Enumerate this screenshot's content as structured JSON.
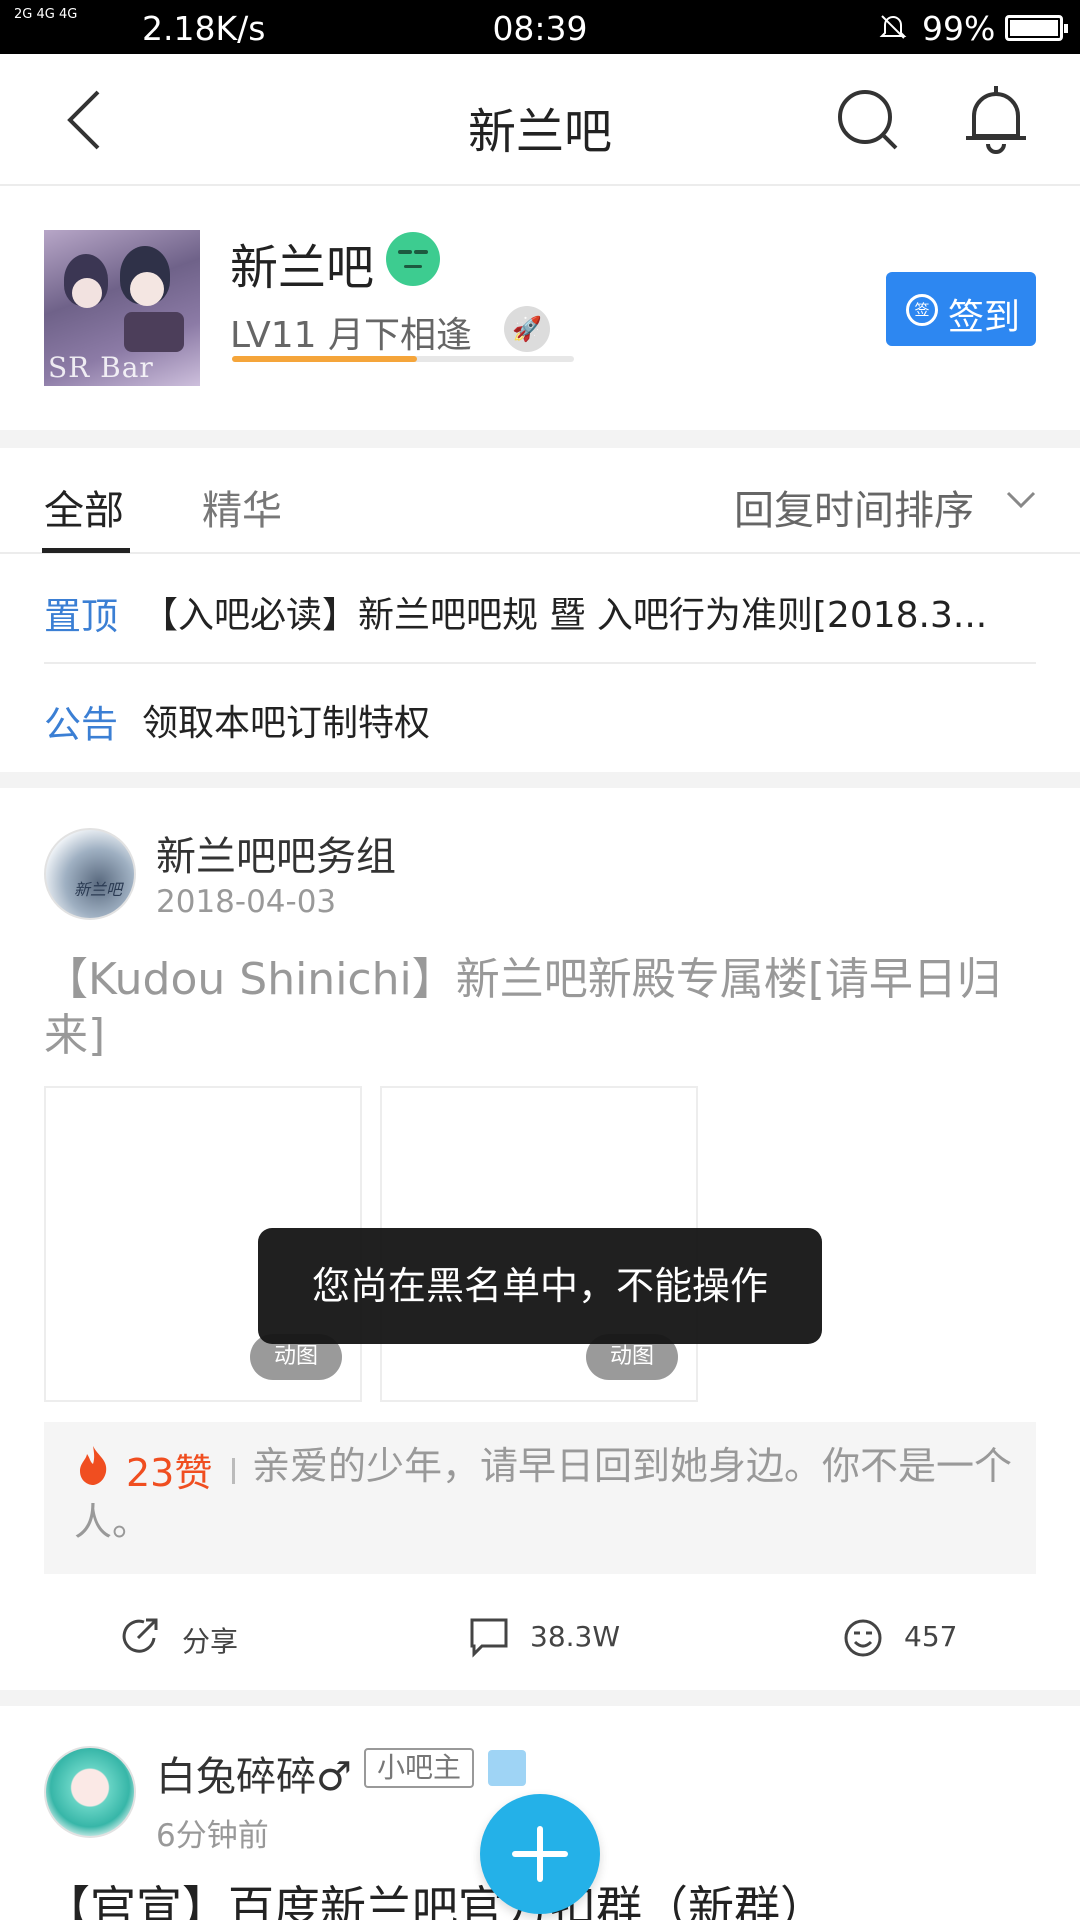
{
  "status_bar": {
    "signal_left": "2G 4G 4G",
    "net_speed": "2.18K/s",
    "time": "08:39",
    "battery": "99%"
  },
  "nav": {
    "title": "新兰吧",
    "icons": [
      "back-arrow-icon",
      "search-icon",
      "bell-icon"
    ]
  },
  "forum": {
    "name": "新兰吧",
    "avatar_text": "SR Bar",
    "level_text": "LV11 月下相逢",
    "level_progress": 0.54,
    "signin_icon_text": "签",
    "signin_label": "签到"
  },
  "tabs": {
    "all": "全部",
    "featured": "精华",
    "sort": "回复时间排序"
  },
  "pinned": [
    {
      "tag": "置顶",
      "text": "【入吧必读】新兰吧吧规 暨 入吧行为准则[2018.3..."
    },
    {
      "tag": "公告",
      "text": "领取本吧订制特权"
    }
  ],
  "post1": {
    "author": "新兰吧吧务组",
    "date": "2018-04-03",
    "title": "【Kudou Shinichi】新兰吧新殿专属楼[请早日归来]",
    "thumb_badge_1": "动图",
    "thumb_badge_2": "动图",
    "likes": "23赞",
    "quote": "亲爱的少年，请早日回到她身边。你不是一个人。",
    "share_label": "分享",
    "comment_count": "38.3W",
    "like_count": "457"
  },
  "post2": {
    "author": "白兔碎碎♂",
    "badge": "小吧主",
    "date": "6分钟前",
    "title": "【官宣】百度新兰吧官方扣群（新群）"
  },
  "toast": "您尚在黑名单中，不能操作",
  "colors": {
    "accent_blue": "#2d87f1",
    "fab_blue": "#24b1e8",
    "tag_blue": "#3b7fd4",
    "like_red": "#f04e20",
    "progress_orange": "#f5a53a"
  }
}
